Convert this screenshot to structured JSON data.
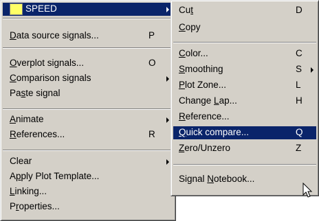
{
  "left_menu": {
    "header": {
      "label": "SPEED",
      "swatch_color": "#ffff66"
    },
    "items": [
      {
        "pre": "",
        "u": "D",
        "post": "ata source signals...",
        "key": "P"
      },
      {
        "pre": "",
        "u": "O",
        "post": "verplot signals...",
        "key": "O"
      },
      {
        "pre": "",
        "u": "C",
        "post": "omparison signals",
        "key": ""
      },
      {
        "pre": "Pa",
        "u": "s",
        "post": "te signal",
        "key": ""
      },
      {
        "pre": "",
        "u": "A",
        "post": "nimate",
        "key": ""
      },
      {
        "pre": "",
        "u": "R",
        "post": "eferences...",
        "key": "R"
      },
      {
        "pre": "Clear",
        "u": "",
        "post": "",
        "key": ""
      },
      {
        "pre": "A",
        "u": "p",
        "post": "ply Plot Template...",
        "key": ""
      },
      {
        "pre": "",
        "u": "L",
        "post": "inking...",
        "key": ""
      },
      {
        "pre": "P",
        "u": "r",
        "post": "operties...",
        "key": ""
      }
    ]
  },
  "right_menu": {
    "items": [
      {
        "pre": "Cu",
        "u": "t",
        "post": "",
        "key": "D"
      },
      {
        "pre": "",
        "u": "C",
        "post": "opy",
        "key": ""
      },
      {
        "pre": "",
        "u": "C",
        "post": "olor...",
        "key": "C"
      },
      {
        "pre": "",
        "u": "S",
        "post": "moothing",
        "key": "S"
      },
      {
        "pre": "",
        "u": "P",
        "post": "lot Zone...",
        "key": "L"
      },
      {
        "pre": "Change ",
        "u": "L",
        "post": "ap...",
        "key": "H"
      },
      {
        "pre": "",
        "u": "R",
        "post": "eference...",
        "key": ""
      },
      {
        "pre": "",
        "u": "Q",
        "post": "uick compare...",
        "key": "Q"
      },
      {
        "pre": "",
        "u": "Z",
        "post": "ero/Unzero",
        "key": "Z"
      },
      {
        "pre": "Signal ",
        "u": "N",
        "post": "otebook...",
        "key": ""
      }
    ]
  },
  "colors": {
    "menu_bg": "#d4d0c8",
    "highlight": "#0a246a",
    "highlight_text": "#ffffff"
  },
  "cursor": {
    "icon": "arrow-pointer-icon"
  }
}
